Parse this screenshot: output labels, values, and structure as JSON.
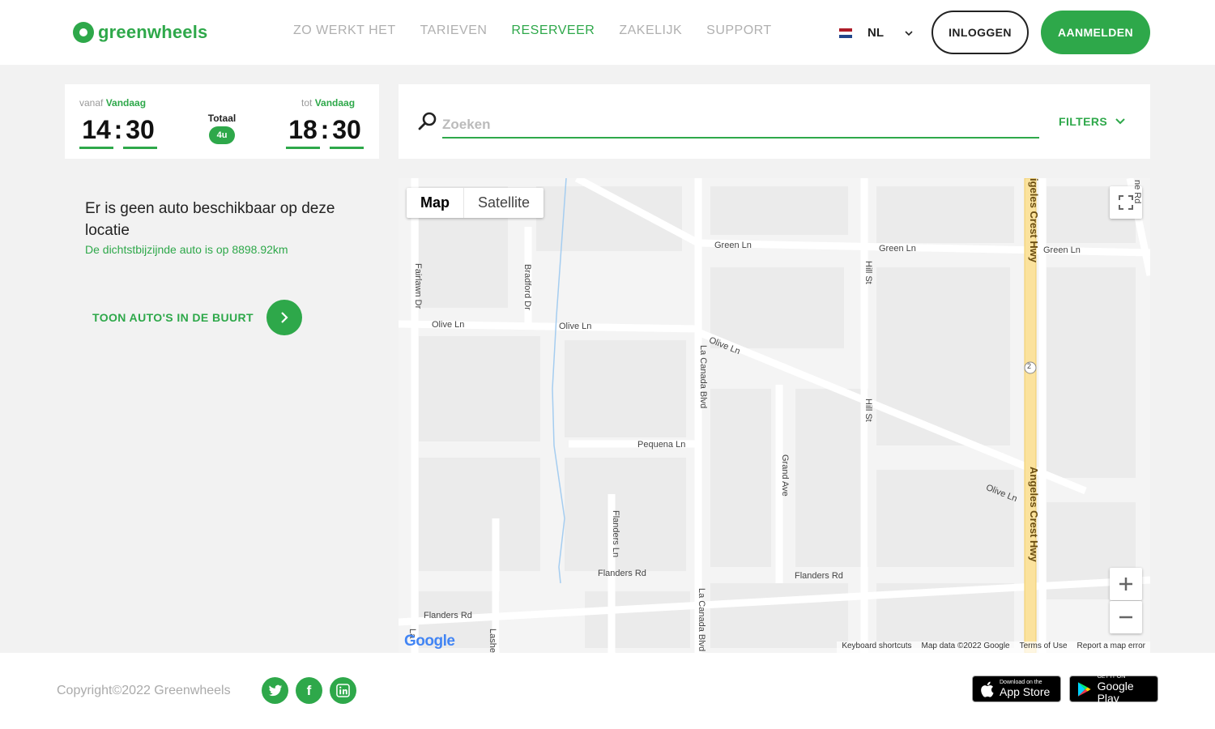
{
  "brand": {
    "name": "greenwheels",
    "color": "#2ea84a"
  },
  "nav": [
    {
      "label": "ZO WERKT HET",
      "active": false
    },
    {
      "label": "TARIEVEN",
      "active": false
    },
    {
      "label": "RESERVEER",
      "active": true
    },
    {
      "label": "ZAKELIJK",
      "active": false
    },
    {
      "label": "SUPPORT",
      "active": false
    }
  ],
  "language": {
    "code": "NL",
    "icon": "flag-netherlands-icon"
  },
  "auth": {
    "login_label": "INLOGGEN",
    "signup_label": "AANMELDEN"
  },
  "booking": {
    "from_prefix": "vanaf",
    "from_day": "Vandaag",
    "from_hours": "14",
    "from_minutes": "30",
    "to_prefix": "tot",
    "to_day": "Vandaag",
    "to_hours": "18",
    "to_minutes": "30",
    "total_label": "Totaal",
    "total_value": "4u"
  },
  "search": {
    "placeholder": "Zoeken",
    "value": "",
    "filters_label": "FILTERS"
  },
  "result": {
    "message": "Er is geen auto beschikbaar op deze locatie",
    "nearest": "De dichtstbijzijnde auto is op 8898.92km",
    "nearby_label": "TOON AUTO'S IN DE BUURT"
  },
  "map": {
    "type_map": "Map",
    "type_satellite": "Satellite",
    "active_type": "Map",
    "streets": {
      "green_ln": "Green Ln",
      "olive_ln": "Olive Ln",
      "pequena_ln": "Pequena Ln",
      "flanders_rd": "Flanders Rd",
      "fairlawn_dr": "Fairlawn Dr",
      "bradford_dr": "Bradford Dr",
      "la_canada_blvd": "La Canada Blvd",
      "hill_st": "Hill St",
      "grand_ave": "Grand Ave",
      "flanders_ln": "Flanders Ln",
      "angeles_crest_hwy": "Angeles Crest Hwy",
      "angeles_crest_hwy_top": "igeles Crest Hwy",
      "route_number": "2",
      "edge_right": "ne Rd",
      "edge_la": "La",
      "edge_lashe": "Lashe"
    },
    "footer": {
      "keyboard": "Keyboard shortcuts",
      "map_data": "Map data ©2022 Google",
      "terms": "Terms of Use",
      "report": "Report a map error"
    },
    "google_logo": "Google"
  },
  "footer": {
    "copyright": "Copyright©2022 Greenwheels",
    "social": [
      {
        "name": "twitter-icon"
      },
      {
        "name": "facebook-icon"
      },
      {
        "name": "linkedin-icon"
      }
    ],
    "app_store": {
      "small": "Download on the",
      "big": "App Store"
    },
    "google_play": {
      "small": "GET IT ON",
      "big": "Google Play"
    }
  }
}
